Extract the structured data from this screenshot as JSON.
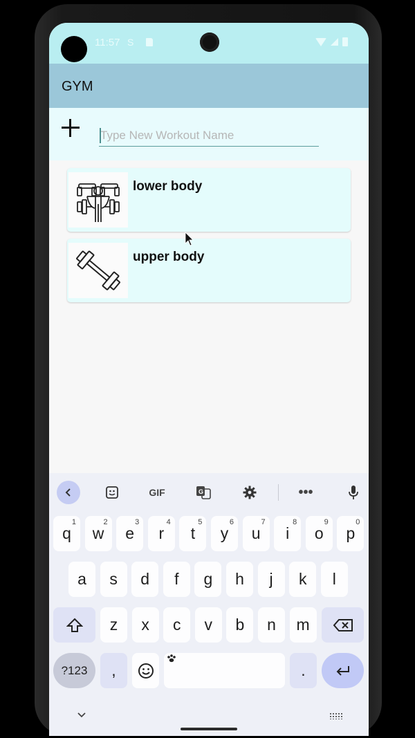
{
  "status_bar": {
    "time": "11:57",
    "s_indicator": "S"
  },
  "app_bar": {
    "title": "GYM"
  },
  "new_workout": {
    "placeholder": "Type New Workout Name",
    "value": ""
  },
  "workouts": [
    {
      "label": "lower body",
      "icon": "dumbbell-figure-icon"
    },
    {
      "label": "upper body",
      "icon": "barbell-icon"
    }
  ],
  "keyboard": {
    "toolbar": {
      "gif_label": "GIF"
    },
    "row1": [
      {
        "k": "q",
        "n": "1"
      },
      {
        "k": "w",
        "n": "2"
      },
      {
        "k": "e",
        "n": "3"
      },
      {
        "k": "r",
        "n": "4"
      },
      {
        "k": "t",
        "n": "5"
      },
      {
        "k": "y",
        "n": "6"
      },
      {
        "k": "u",
        "n": "7"
      },
      {
        "k": "i",
        "n": "8"
      },
      {
        "k": "o",
        "n": "9"
      },
      {
        "k": "p",
        "n": "0"
      }
    ],
    "row2": [
      "a",
      "s",
      "d",
      "f",
      "g",
      "h",
      "j",
      "k",
      "l"
    ],
    "row3": [
      "z",
      "x",
      "c",
      "v",
      "b",
      "n",
      "m"
    ],
    "symbols_label": "?123",
    "comma_label": ",",
    "period_label": ".",
    "colors": {
      "background": "#eef0f7",
      "key": "#fdfdfe",
      "accent": "#c1c9f6"
    }
  },
  "colors": {
    "status_bar": "#b9eef1",
    "app_bar": "#9bc7d9",
    "card": "#e4fcfc",
    "input_row": "#e8fbfd"
  }
}
